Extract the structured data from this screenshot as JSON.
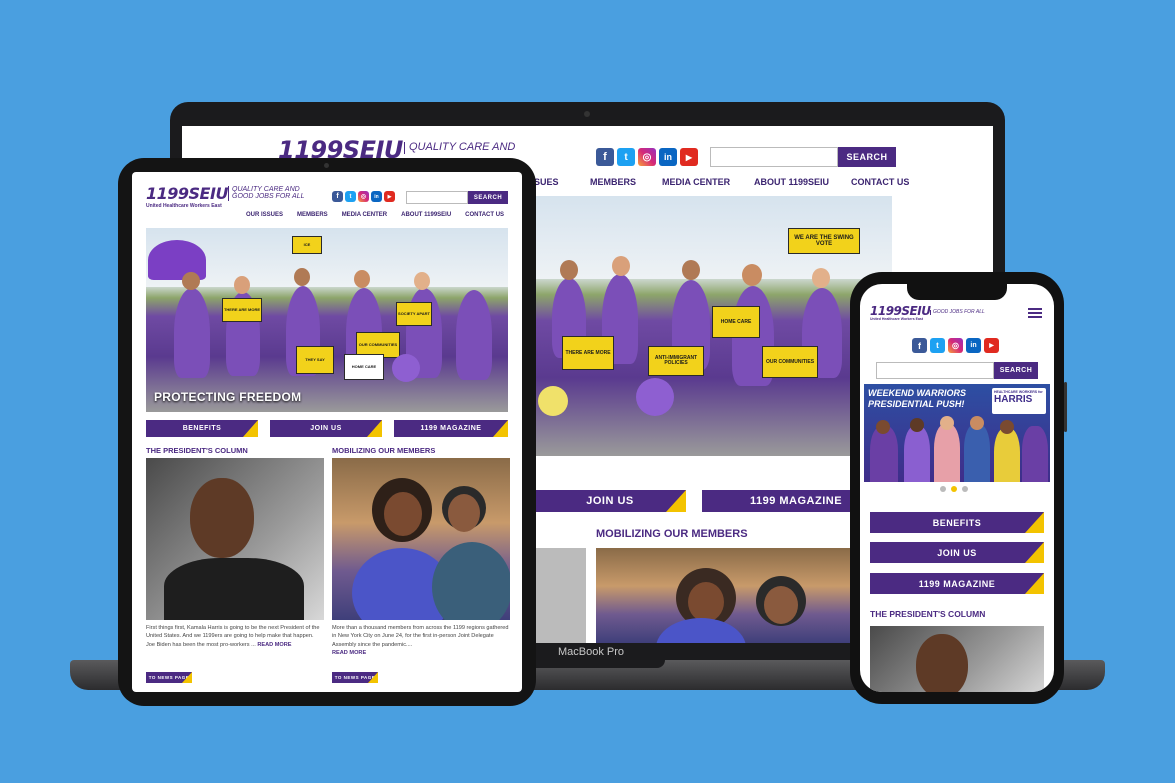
{
  "site": {
    "logo": "1199SEIU",
    "tagline_line1": "QUALITY CARE AND",
    "tagline_line2": "GOOD JOBS FOR ALL",
    "sub": "United Healthcare Workers East",
    "search_label": "SEARCH",
    "nav": [
      "OUR ISSUES",
      "MEMBERS",
      "MEDIA CENTER",
      "ABOUT 1199SEIU",
      "CONTACT US"
    ],
    "nav_laptop_clip": "SUES",
    "social": [
      {
        "icon": "facebook-icon",
        "glyph": "f",
        "cls": "fb"
      },
      {
        "icon": "twitter-icon",
        "glyph": "t",
        "cls": "tw"
      },
      {
        "icon": "instagram-icon",
        "glyph": "◎",
        "cls": "ig"
      },
      {
        "icon": "linkedin-icon",
        "glyph": "in",
        "cls": "li"
      },
      {
        "icon": "youtube-icon",
        "glyph": "▶",
        "cls": "yt"
      }
    ],
    "colors": {
      "purple": "#4b2a82",
      "yellow": "#f3c300",
      "background": "#4a9fe0"
    }
  },
  "laptop": {
    "brand_label": "MacBook Pro",
    "buttons": [
      "JOIN US",
      "1199 MAGAZINE"
    ],
    "section_title": "MOBILIZING OUR MEMBERS",
    "sign_text": "WE ARE THE SWING VOTE"
  },
  "tablet": {
    "hero_caption": "PROTECTING FREEDOM",
    "buttons": [
      "BENEFITS",
      "JOIN US",
      "1199 MAGAZINE"
    ],
    "col1": {
      "title": "THE PRESIDENT'S COLUMN",
      "text": "First things first, Kamala Harris is going to be the next President of the United States. And we 1199ers are going to help make that happen. Joe Biden has been the most pro-workers ... ",
      "read_more": "READ MORE",
      "button": "TO NEWS PAGE"
    },
    "col2": {
      "title": "MOBILIZING OUR MEMBERS",
      "text": "More than a thousand members from across the 1199 regions gathered in New York City on June 24, for the first in-person Joint Delegate Assembly since the pandemic.... ",
      "read_more": "READ MORE",
      "button": "TO NEWS PAGE"
    }
  },
  "phone": {
    "menu_icon": "hamburger-menu-icon",
    "banner_line1": "WEEKEND WARRIORS",
    "banner_line2": "PRESIDENTIAL PUSH!",
    "banner_badge_top": "HEALTHCARE WORKERS for",
    "banner_badge_name": "HARRIS",
    "buttons": [
      "BENEFITS",
      "JOIN US",
      "1199 MAGAZINE"
    ],
    "section_title": "THE PRESIDENT'S COLUMN",
    "carousel_dots": 3,
    "carousel_active": 1
  }
}
